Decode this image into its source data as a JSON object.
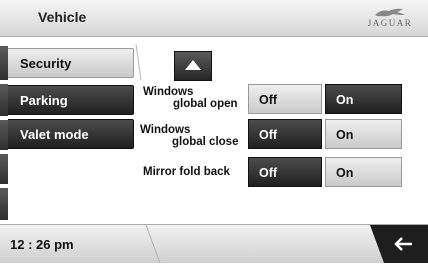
{
  "header": {
    "title": "Vehicle",
    "brand": "JAGUAR"
  },
  "menu": {
    "items": [
      {
        "label": "Security",
        "state": "inactive"
      },
      {
        "label": "Parking",
        "state": "active"
      },
      {
        "label": "Valet mode",
        "state": "active"
      }
    ]
  },
  "scroll_up_icon": "up-arrow-icon",
  "settings": [
    {
      "label_line1": "Windows",
      "label_line2": "global open",
      "off": "Off",
      "on": "On",
      "selected": "On"
    },
    {
      "label_line1": "Windows",
      "label_line2": "global close",
      "off": "Off",
      "on": "On",
      "selected": "Off"
    },
    {
      "label_line1": "Mirror fold back",
      "label_line2": "",
      "off": "Off",
      "on": "On",
      "selected": "Off"
    }
  ],
  "footer": {
    "time": "12 : 26 pm",
    "back_icon": "back-arrow-icon"
  },
  "colors": {
    "dark": "#2a2a2a",
    "light": "#dcdcdc"
  }
}
